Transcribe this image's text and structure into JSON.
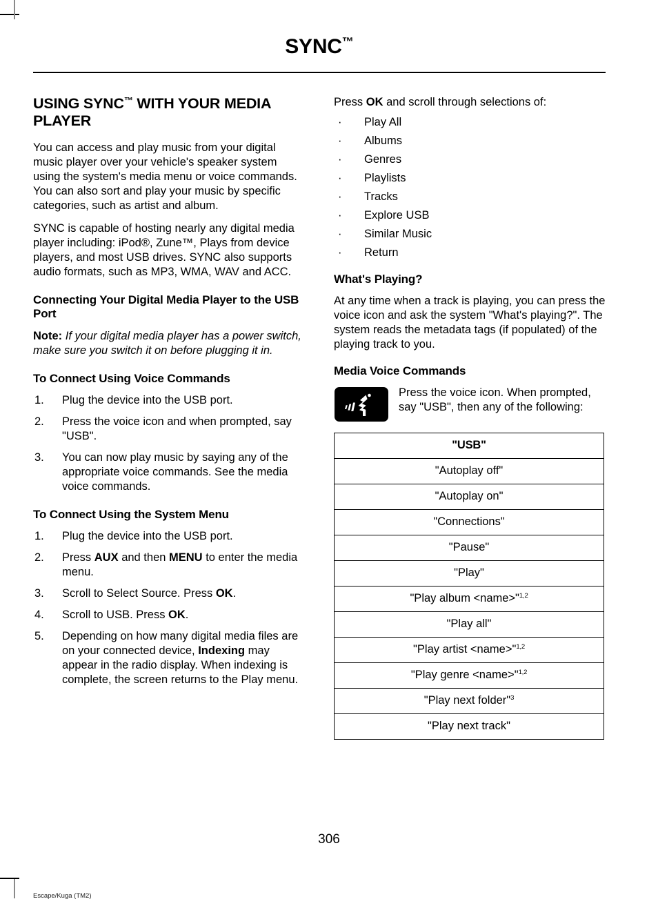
{
  "header": {
    "title": "SYNC",
    "title_tm": "™"
  },
  "left_column": {
    "section_heading_line1": "USING SYNC",
    "section_heading_tm": "™",
    "section_heading_line2": " WITH YOUR MEDIA PLAYER",
    "para1": "You can access and play music from your digital music player over your vehicle's speaker system using the system's media menu or voice commands. You can also sort and play your music by specific categories, such as artist and album.",
    "para2": "SYNC is capable of hosting nearly any digital media player including: iPod®, Zune™, Plays from device players, and most USB drives. SYNC also supports audio formats, such as MP3, WMA, WAV and ACC.",
    "subheading_connecting": "Connecting Your Digital Media Player to the USB Port",
    "note_label": "Note:",
    "note_text": " If your digital media player has a power switch, make sure you switch it on before plugging it in.",
    "subheading_voice": "To Connect Using Voice Commands",
    "voice_steps": [
      {
        "num": "1.",
        "text": "Plug the device into the USB port."
      },
      {
        "num": "2.",
        "text": "Press the voice icon and when prompted, say \"USB\"."
      },
      {
        "num": "3.",
        "text": "You can now play music by saying any of the appropriate voice commands. See the media voice commands."
      }
    ],
    "subheading_menu": "To Connect Using the System Menu",
    "menu_steps": [
      {
        "num": "1.",
        "pre": "Plug the device into the USB port.",
        "bold": "",
        "post": ""
      },
      {
        "num": "2.",
        "pre": "Press ",
        "bold": "AUX",
        "mid": " and then ",
        "bold2": "MENU",
        "post": " to enter the media menu."
      },
      {
        "num": "3.",
        "pre": "Scroll to Select Source. Press ",
        "bold": "OK",
        "post": "."
      },
      {
        "num": "4.",
        "pre": "Scroll to USB. Press ",
        "bold": "OK",
        "post": "."
      },
      {
        "num": "5.",
        "pre": "Depending on how many digital media files are on your connected device, ",
        "bold": "Indexing",
        "post": " may appear in the radio display. When indexing is complete, the screen returns to the Play menu."
      }
    ]
  },
  "right_column": {
    "press_ok_pre": "Press ",
    "press_ok_bold": "OK",
    "press_ok_post": " and scroll through selections of:",
    "bullet_char": "·",
    "selections": [
      "Play All",
      "Albums",
      "Genres",
      "Playlists",
      "Tracks",
      "Explore USB",
      "Similar Music",
      "Return"
    ],
    "whats_playing_heading": "What's Playing?",
    "whats_playing_text": "At any time when a track is playing, you can press the voice icon and ask the system \"What's playing?\". The system reads the metadata tags (if populated) of the playing track to you.",
    "media_voice_heading": "Media Voice Commands",
    "voice_icon_name": "voice-command-icon",
    "voice_instruction": "Press the voice icon. When prompted, say \"USB\", then any of the following:",
    "command_table": {
      "header": "\"USB\"",
      "rows": [
        {
          "text": "\"Autoplay off\"",
          "sup": ""
        },
        {
          "text": "\"Autoplay on\"",
          "sup": ""
        },
        {
          "text": "\"Connections\"",
          "sup": ""
        },
        {
          "text": "\"Pause\"",
          "sup": ""
        },
        {
          "text": "\"Play\"",
          "sup": ""
        },
        {
          "text": "\"Play album <name>\"",
          "sup": "1,2"
        },
        {
          "text": "\"Play all\"",
          "sup": ""
        },
        {
          "text": "\"Play artist <name>\"",
          "sup": "1,2"
        },
        {
          "text": "\"Play genre <name>\"",
          "sup": "1,2"
        },
        {
          "text": "\"Play next folder\"",
          "sup": "3"
        },
        {
          "text": "\"Play next track\"",
          "sup": ""
        }
      ]
    }
  },
  "footer": {
    "page_number": "306",
    "doc_code": "Escape/Kuga (TM2)"
  }
}
